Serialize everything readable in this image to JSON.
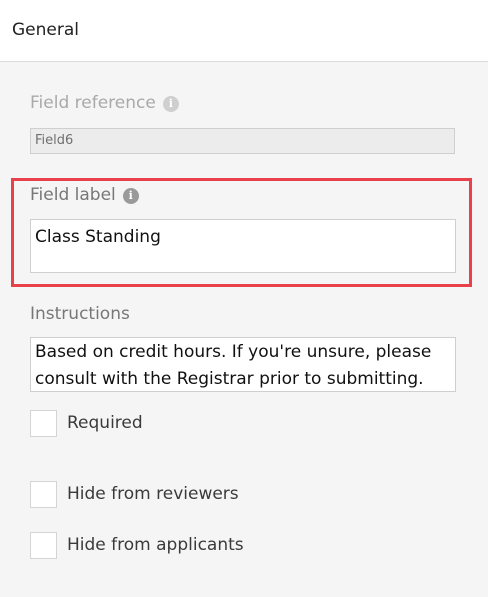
{
  "header": {
    "title": "General"
  },
  "field_reference": {
    "label": "Field reference",
    "value": "Field6",
    "info_icon": "info-icon"
  },
  "field_label": {
    "label": "Field label",
    "value": "Class Standing",
    "info_icon": "info-icon",
    "highlight_color": "#e8414b"
  },
  "instructions": {
    "label": "Instructions",
    "value": "Based on credit hours. If you're unsure, please consult with the Registrar prior to submitting."
  },
  "options": [
    {
      "label": "Required",
      "checked": false
    },
    {
      "label": "Hide from reviewers",
      "checked": false
    },
    {
      "label": "Hide from applicants",
      "checked": false
    }
  ]
}
